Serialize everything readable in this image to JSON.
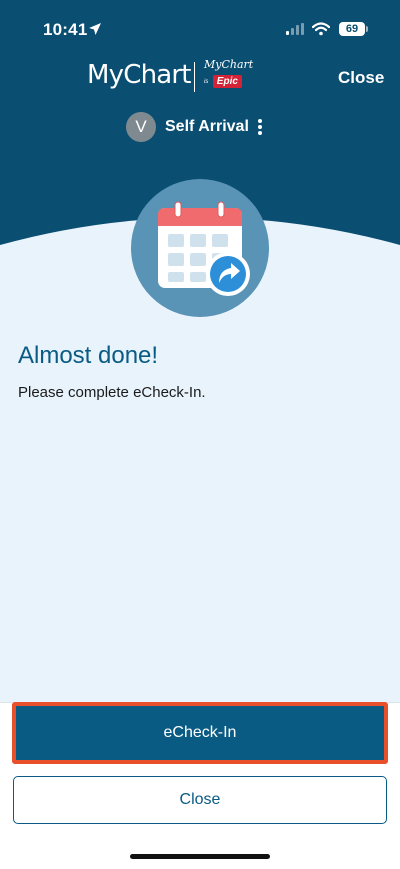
{
  "status_bar": {
    "time": "10:41",
    "battery": "69"
  },
  "header": {
    "logo_text": "MyChart",
    "logo_by_text": "MyChart",
    "logo_is_text": "is",
    "logo_epic_text": "Epic",
    "close_label": "Close"
  },
  "account": {
    "avatar_initial": "V",
    "name": "Self Arrival"
  },
  "hero": {
    "icon": "calendar-share-icon"
  },
  "message": {
    "headline": "Almost done!",
    "body": "Please complete eCheck-In."
  },
  "actions": {
    "primary_label": "eCheck-In",
    "secondary_label": "Close"
  },
  "colors": {
    "brand_dark": "#0a4e72",
    "accent_blue": "#0a5b83",
    "highlight_border": "#e8502c",
    "background_light": "#e8f3fb",
    "epic_red": "#d42236"
  }
}
